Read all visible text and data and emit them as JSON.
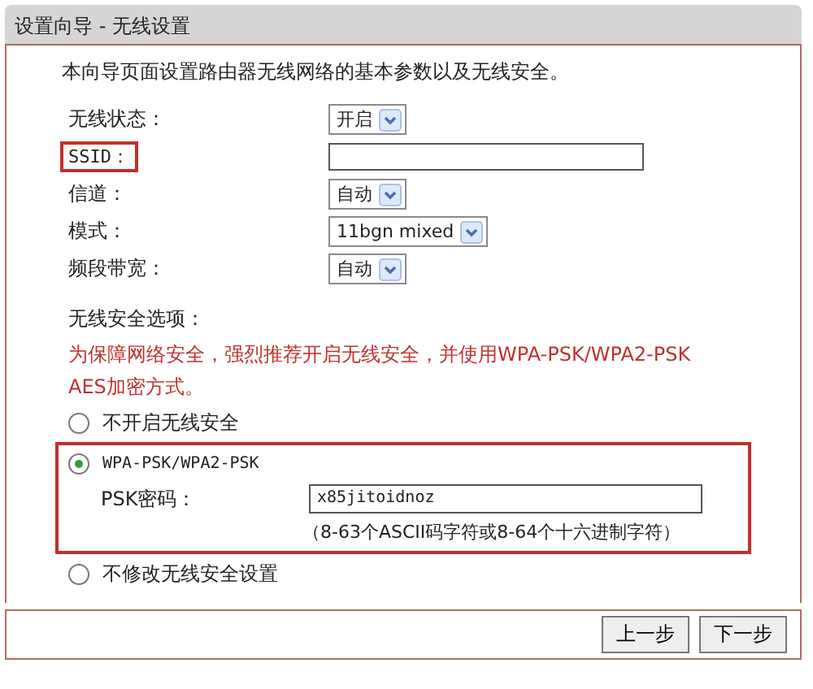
{
  "window": {
    "title": "设置向导 - 无线设置"
  },
  "intro": "本向导页面设置路由器无线网络的基本参数以及无线安全。",
  "fields": [
    {
      "label": "无线状态：",
      "kind": "select",
      "value": "开启",
      "highlighted": false
    },
    {
      "label": "SSID：",
      "kind": "text",
      "highlighted": true
    },
    {
      "label": "信道：",
      "kind": "select",
      "value": "自动",
      "highlighted": false
    },
    {
      "label": "模式：",
      "kind": "select",
      "value": "11bgn mixed",
      "highlighted": false
    },
    {
      "label": "频段带宽：",
      "kind": "select",
      "value": "自动",
      "highlighted": false
    }
  ],
  "security": {
    "heading": "无线安全选项：",
    "warning": "为保障网络安全，强烈推荐开启无线安全，并使用WPA-PSK/WPA2-PSK AES加密方式。",
    "options": [
      {
        "kind": "plain",
        "label": "不开启无线安全",
        "selected": false,
        "highlighted": false
      },
      {
        "kind": "wpa",
        "label": "WPA-PSK/WPA2-PSK",
        "selected": true,
        "highlighted": true,
        "psk_label": "PSK密码：",
        "psk_value": "x85jitoidnoz",
        "psk_hint": "（8-63个ASCII码字符或8-64个十六进制字符）"
      },
      {
        "kind": "plain",
        "label": "不修改无线安全设置",
        "selected": false,
        "highlighted": false
      }
    ]
  },
  "buttons": [
    "上一步",
    "下一步"
  ]
}
